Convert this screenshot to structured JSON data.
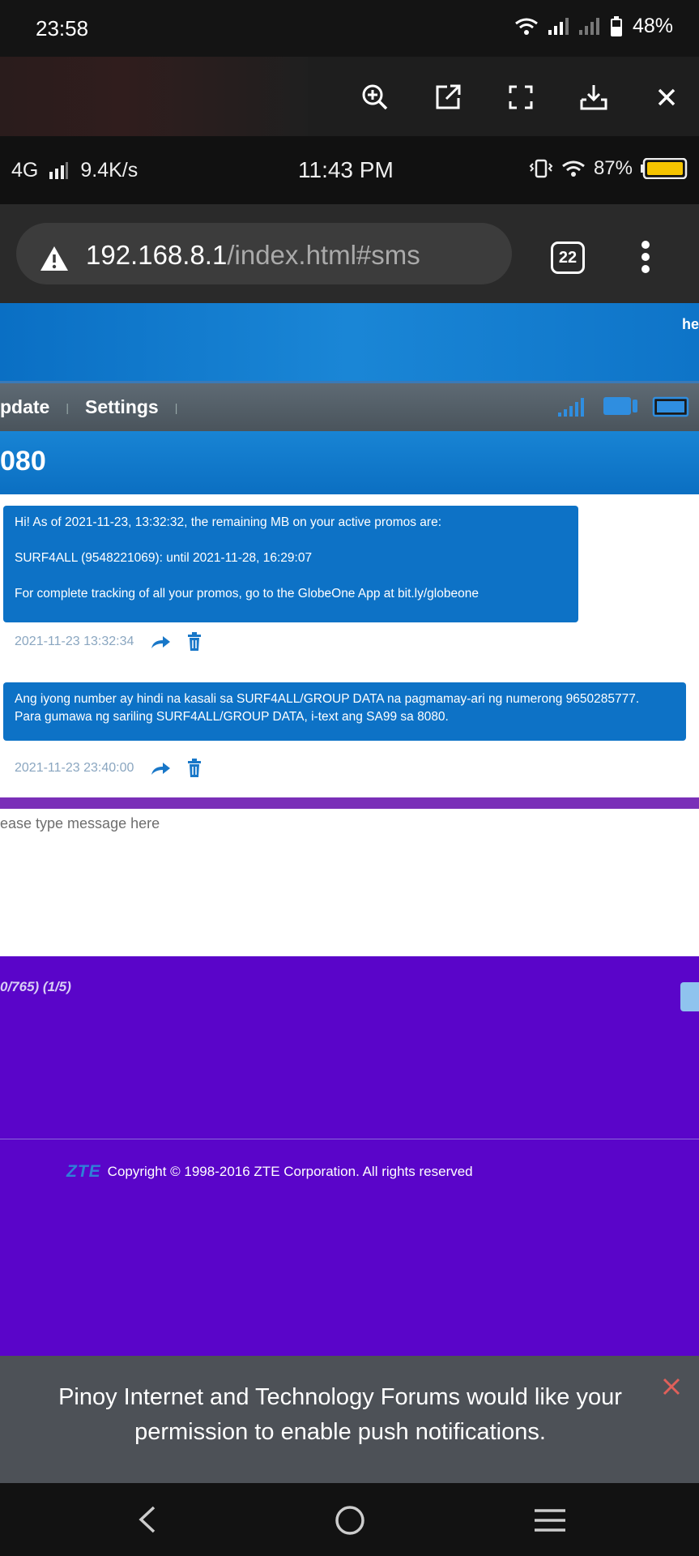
{
  "status_bar": {
    "time": "23:58",
    "battery": "48%"
  },
  "viewer_tools": [
    "zoom-in-icon",
    "open-external-icon",
    "fullscreen-icon",
    "download-icon",
    "close-icon"
  ],
  "inner_status": {
    "network": "4G",
    "speed": "9.4K/s",
    "time": "11:43 PM",
    "battery": "87%"
  },
  "browser": {
    "url_host": "192.168.8.1",
    "url_path": "/index.html#sms",
    "tab_count": "22"
  },
  "router": {
    "header_text": "he",
    "nav_items": [
      "pdate",
      "Settings"
    ],
    "title": "080",
    "messages": [
      {
        "text": "Hi! As of 2021-11-23, 13:32:32, the remaining MB on your active promos are:\n\nSURF4ALL (9548221069): until 2021-11-28, 16:29:07\n\nFor complete tracking of all your promos, go to the GlobeOne App at bit.ly/globeone",
        "timestamp": "2021-11-23 13:32:34"
      },
      {
        "text": "Ang iyong number ay hindi na kasali sa SURF4ALL/GROUP DATA na pagmamay-ari ng numerong 9650285777.\nPara gumawa ng sariling SURF4ALL/GROUP DATA, i-text ang SA99 sa 8080.",
        "timestamp": "2021-11-23 23:40:00"
      }
    ],
    "compose_placeholder": "ease type message here",
    "char_count": "0/765) (1/5)",
    "footer_logo": "ZTE",
    "copyright": "Copyright © 1998-2016 ZTE Corporation. All rights reserved"
  },
  "push_prompt": {
    "message": "Pinoy Internet and Technology Forums would like your permission to enable push notifications."
  },
  "colors": {
    "bubble": "#0d72c6",
    "page_purple": "#5a05c9",
    "header_blue": "#0a6fc4",
    "push_bg": "#4d5157",
    "close_red": "#e0605a"
  }
}
